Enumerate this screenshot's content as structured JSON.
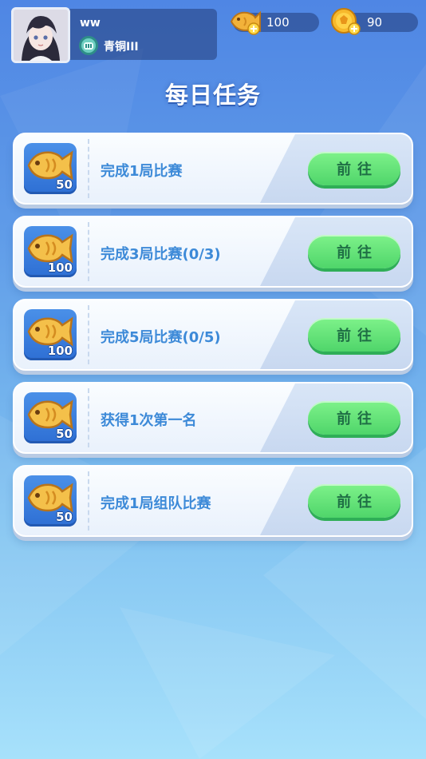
{
  "profile": {
    "username": "ww",
    "rank": "青铜III"
  },
  "currencies": {
    "fish": {
      "icon": "fish-coin-plus-icon",
      "value": "100"
    },
    "coin": {
      "icon": "gold-coin-plus-icon",
      "value": "90"
    }
  },
  "page": {
    "title": "每日任务"
  },
  "tasks": [
    {
      "label": "完成1局比赛",
      "reward_icon": "golden-fish-icon",
      "reward": "50",
      "button": "前往"
    },
    {
      "label": "完成3局比赛(0/3)",
      "reward_icon": "golden-fish-icon",
      "reward": "100",
      "button": "前往"
    },
    {
      "label": "完成5局比赛(0/5)",
      "reward_icon": "golden-fish-icon",
      "reward": "100",
      "button": "前往"
    },
    {
      "label": "获得1次第一名",
      "reward_icon": "golden-fish-icon",
      "reward": "50",
      "button": "前往"
    },
    {
      "label": "完成1局组队比赛",
      "reward_icon": "golden-fish-icon",
      "reward": "50",
      "button": "前往"
    }
  ],
  "colors": {
    "background_top": "#4f86e4",
    "background_bottom": "#a7e1fb",
    "task_text": "#3d8ad8",
    "button_green": "#5fe07a",
    "button_text": "#1f6f45"
  }
}
